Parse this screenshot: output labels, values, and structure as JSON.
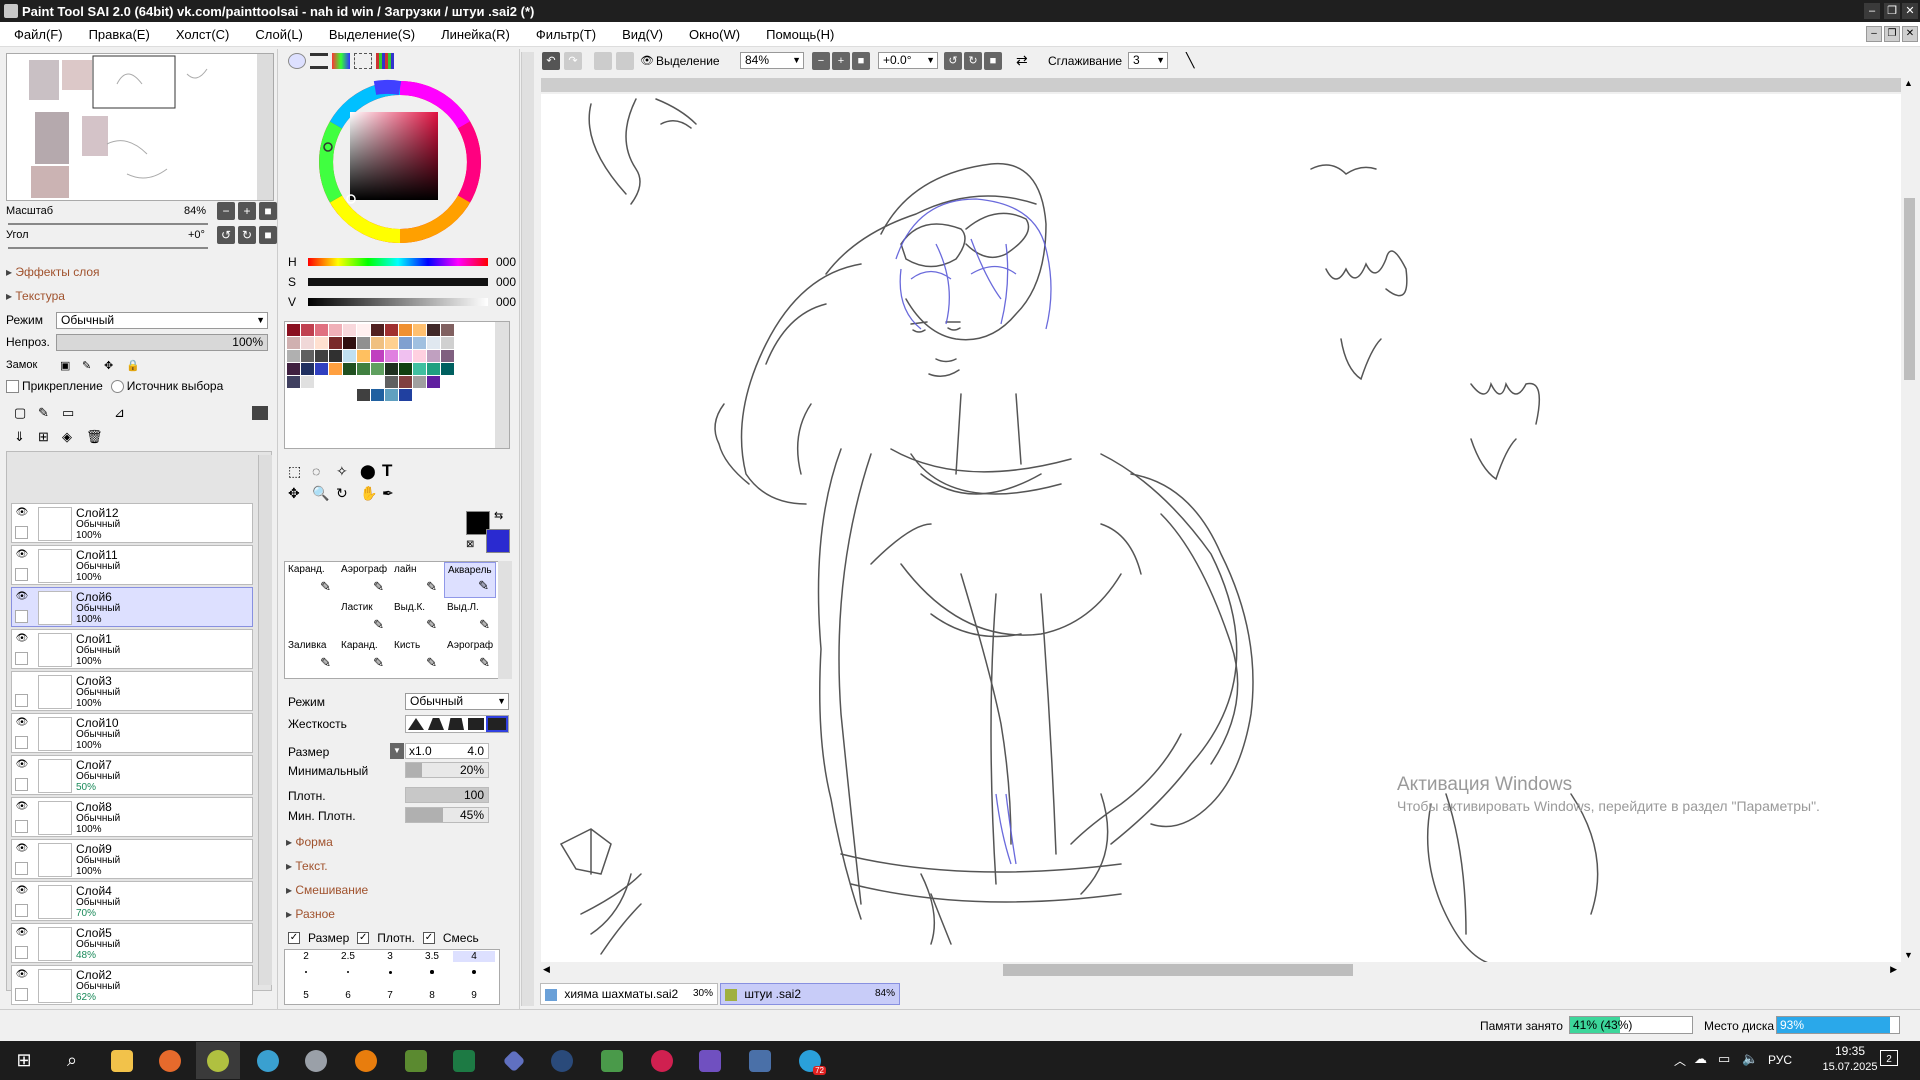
{
  "window": {
    "title": "Paint Tool SAI 2.0 (64bit) vk.com/painttoolsai - nah id win / Загрузки / штуи .sai2 (*)"
  },
  "menu": [
    "Файл(F)",
    "Правка(E)",
    "Холст(C)",
    "Слой(L)",
    "Выделение(S)",
    "Линейка(R)",
    "Фильтр(T)",
    "Вид(V)",
    "Окно(W)",
    "Помощь(H)"
  ],
  "navigator": {
    "scale_label": "Масштаб",
    "scale_value": "84%",
    "angle_label": "Угол",
    "angle_value": "+0°"
  },
  "layer_panel": {
    "effects": "Эффекты слоя",
    "texture": "Текстура",
    "mode_label": "Режим",
    "mode_value": "Обычный",
    "opacity_label": "Непроз.",
    "opacity_value": "100%",
    "lock_label": "Замок",
    "clip_label": "Прикрепление",
    "selsrc_label": "Источник выбора",
    "layers": [
      {
        "name": "Слой12",
        "mode": "Обычный",
        "opacity": "100%",
        "visible": true,
        "selected": false
      },
      {
        "name": "Слой11",
        "mode": "Обычный",
        "opacity": "100%",
        "visible": true,
        "selected": false
      },
      {
        "name": "Слой6",
        "mode": "Обычный",
        "opacity": "100%",
        "visible": true,
        "selected": true
      },
      {
        "name": "Слой1",
        "mode": "Обычный",
        "opacity": "100%",
        "visible": true,
        "selected": false
      },
      {
        "name": "Слой3",
        "mode": "Обычный",
        "opacity": "100%",
        "visible": false,
        "selected": false
      },
      {
        "name": "Слой10",
        "mode": "Обычный",
        "opacity": "100%",
        "visible": true,
        "selected": false
      },
      {
        "name": "Слой7",
        "mode": "Обычный",
        "opacity": "50%",
        "visible": true,
        "selected": false
      },
      {
        "name": "Слой8",
        "mode": "Обычный",
        "opacity": "100%",
        "visible": true,
        "selected": false
      },
      {
        "name": "Слой9",
        "mode": "Обычный",
        "opacity": "100%",
        "visible": true,
        "selected": false
      },
      {
        "name": "Слой4",
        "mode": "Обычный",
        "opacity": "70%",
        "visible": true,
        "selected": false
      },
      {
        "name": "Слой5",
        "mode": "Обычный",
        "opacity": "48%",
        "visible": true,
        "selected": false
      },
      {
        "name": "Слой2",
        "mode": "Обычный",
        "opacity": "62%",
        "visible": true,
        "selected": false
      }
    ]
  },
  "color": {
    "h_label": "H",
    "h_value": "000",
    "s_label": "S",
    "s_value": "000",
    "v_label": "V",
    "v_value": "000",
    "primary": "#000000",
    "secondary": "#2a2ad0"
  },
  "tools": [
    {
      "label": "Каранд."
    },
    {
      "label": "Аэрограф"
    },
    {
      "label": "лайн"
    },
    {
      "label": "Акварель"
    },
    {
      "label": ""
    },
    {
      "label": "Ластик"
    },
    {
      "label": "Выд.К."
    },
    {
      "label": "Выд.Л."
    },
    {
      "label": "Заливка"
    },
    {
      "label": "Каранд."
    },
    {
      "label": "Кисть"
    },
    {
      "label": "Аэрограф"
    }
  ],
  "brush": {
    "mode_label": "Режим",
    "mode_value": "Обычный",
    "hardness_label": "Жесткость",
    "size_label": "Размер",
    "size_mult": "x1.0",
    "size_value": "4.0",
    "min_label": "Минимальный",
    "min_value": "20%",
    "density_label": "Плотн.",
    "density_value": "100",
    "mindens_label": "Мин. Плотн.",
    "mindens_value": "45%",
    "sections": [
      "Форма",
      "Текст.",
      "Смешивание",
      "Разное"
    ],
    "check_size": "Размер",
    "check_density": "Плотн.",
    "check_mix": "Смесь",
    "presets_top": [
      "2",
      "2.5",
      "3",
      "3.5",
      "4"
    ],
    "presets_bottom": [
      "5",
      "6",
      "7",
      "8",
      "9"
    ]
  },
  "toolbar": {
    "selection_label": "Выделение",
    "zoom": "84%",
    "angle": "+0.0°",
    "smoothing_label": "Сглаживание",
    "smoothing_value": "3"
  },
  "doc_tabs": [
    {
      "name": "хияма шахматы.sai2",
      "zoom": "30%"
    },
    {
      "name": "штуи .sai2",
      "zoom": "84%"
    }
  ],
  "watermark": {
    "title": "Активация Windows",
    "body": "Чтобы активировать Windows, перейдите в раздел \"Параметры\"."
  },
  "status": {
    "mem_label": "Памяти занято",
    "mem_value": "41% (43%)",
    "mem_fraction": 0.41,
    "disk_label": "Место диска",
    "disk_value": "93%",
    "disk_fraction": 0.93
  },
  "taskbar": {
    "lang": "РУС",
    "time": "19:35",
    "date": "15.07.2025",
    "notif": "2",
    "telegram_badge": "72"
  }
}
